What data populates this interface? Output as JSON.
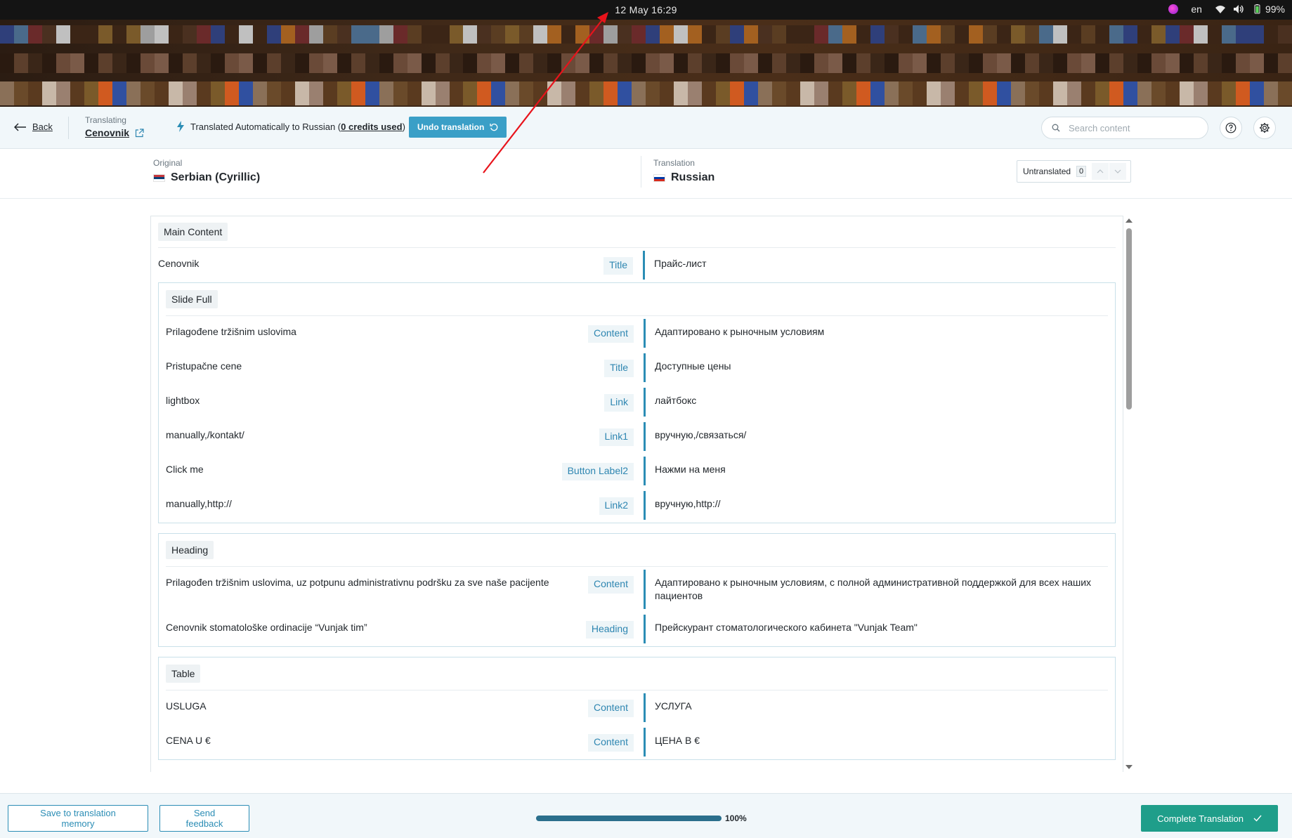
{
  "os_bar": {
    "clock": "12 Мау  16:29",
    "lang": "en",
    "battery": "99%"
  },
  "header": {
    "back_label": "Back",
    "translating_caption": "Translating",
    "page_name": "Cenovnik",
    "auto_prefix": "Translated Automatically to Russian (",
    "auto_credits": "0 credits used",
    "auto_suffix": ")",
    "undo_label": "Undo translation",
    "search_placeholder": "Search content"
  },
  "languages": {
    "original_caption": "Original",
    "original_name": "Serbian (Cyrillic)",
    "translation_caption": "Translation",
    "translation_name": "Russian",
    "untranslated_label": "Untranslated",
    "untranslated_count": "0"
  },
  "sections": [
    {
      "title": "Main Content",
      "rows": [
        {
          "original": "Cenovnik",
          "tag": "Title",
          "translation": "Прайс-лист"
        }
      ]
    },
    {
      "title": "Slide Full",
      "rows": [
        {
          "original": "Prilagođene tržišnim uslovima",
          "tag": "Content",
          "translation": "Адаптировано к рыночным условиям"
        },
        {
          "original": "Pristupačne cene",
          "tag": "Title",
          "translation": "Доступные цены"
        },
        {
          "original": "lightbox",
          "tag": "Link",
          "translation": "лайтбокс"
        },
        {
          "original": "manually,/kontakt/",
          "tag": "Link1",
          "translation": "вручную,/связаться/"
        },
        {
          "original": "Click me",
          "tag": "Button Label2",
          "translation": "Нажми на меня"
        },
        {
          "original": "manually,http://",
          "tag": "Link2",
          "translation": "вручную,http://"
        }
      ]
    },
    {
      "title": "Heading",
      "rows": [
        {
          "original": "Prilagođen tržišnim uslovima, uz potpunu administrativnu podršku za sve naše pacijente",
          "tag": "Content",
          "translation": "Адаптировано к рыночным условиям, с полной административной поддержкой для всех наших пациентов"
        },
        {
          "original": "Cenovnik stomatološke ordinacije “Vunjak tim”",
          "tag": "Heading",
          "translation": "Прейскурант стоматологического кабинета \"Vunjak Team\""
        }
      ]
    },
    {
      "title": "Table",
      "rows": [
        {
          "original": "USLUGA",
          "tag": "Content",
          "translation": "УСЛУГА"
        },
        {
          "original": "CENA U €",
          "tag": "Content",
          "translation": "ЦЕНА В €"
        }
      ]
    }
  ],
  "footer": {
    "save_memory_label": "Save to translation memory",
    "feedback_label": "Send feedback",
    "progress_percent": 100,
    "progress_label": "100%",
    "complete_label": "Complete Translation"
  },
  "colors": {
    "accent": "#2b8db5",
    "complete": "#1f9e8a",
    "annotation_arrow": "#e8131b"
  }
}
